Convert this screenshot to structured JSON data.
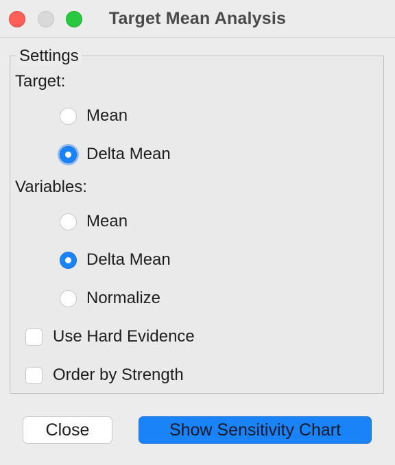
{
  "window": {
    "title": "Target Mean Analysis"
  },
  "settings": {
    "legend": "Settings",
    "target": {
      "label": "Target:",
      "options": [
        {
          "label": "Mean",
          "selected": false
        },
        {
          "label": "Delta Mean",
          "selected": true
        }
      ]
    },
    "variables": {
      "label": "Variables:",
      "options": [
        {
          "label": "Mean",
          "selected": false
        },
        {
          "label": "Delta Mean",
          "selected": true
        },
        {
          "label": "Normalize",
          "selected": false
        }
      ]
    },
    "checkboxes": [
      {
        "label": "Use Hard Evidence",
        "checked": false
      },
      {
        "label": "Order by Strength",
        "checked": false
      }
    ]
  },
  "buttons": {
    "close_label": "Close",
    "show_chart_label": "Show Sensitivity Chart"
  },
  "colors": {
    "accent": "#1a83f7",
    "close_traffic": "#fe5f57",
    "zoom_traffic": "#28c840"
  }
}
